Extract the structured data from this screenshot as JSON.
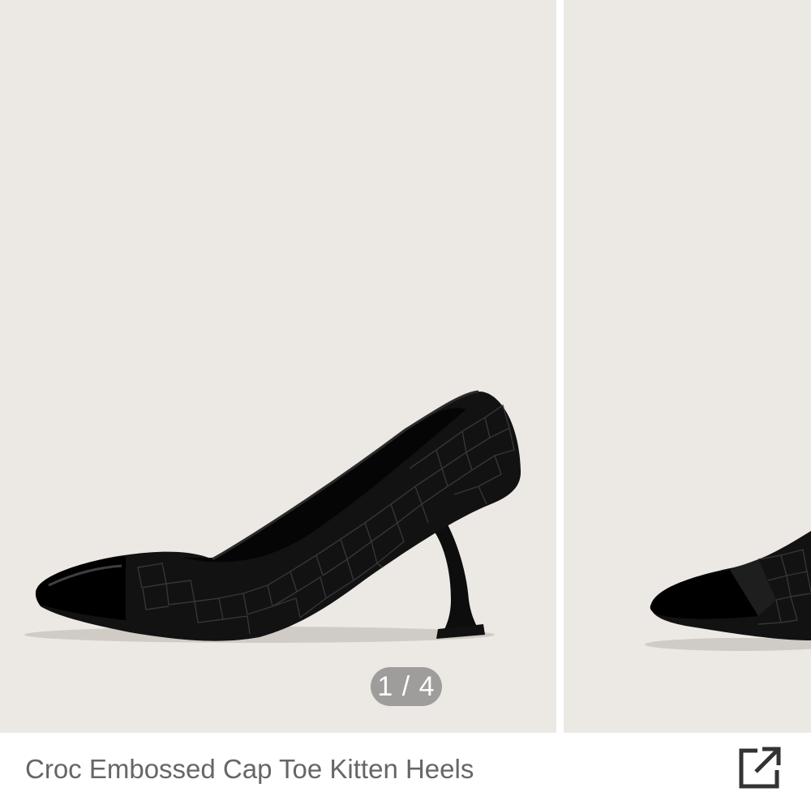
{
  "colors": {
    "photo_background": "#ECE9E4",
    "divider": "#FFFFFF",
    "counter_background": "#8A8A8A",
    "title_text": "#666666",
    "icon": "#333333"
  },
  "gallery": {
    "current_index": 1,
    "total": 4,
    "counter_text": "1 / 4",
    "slides": [
      {
        "subject": "black croc embossed cap toe kitten heel, side view"
      },
      {
        "subject": "black croc embossed cap toe kitten heel, angled view (partially visible)"
      }
    ]
  },
  "product": {
    "title": "Croc Embossed Cap Toe Kitten Heels"
  },
  "icons": {
    "share": "share-external-icon"
  }
}
